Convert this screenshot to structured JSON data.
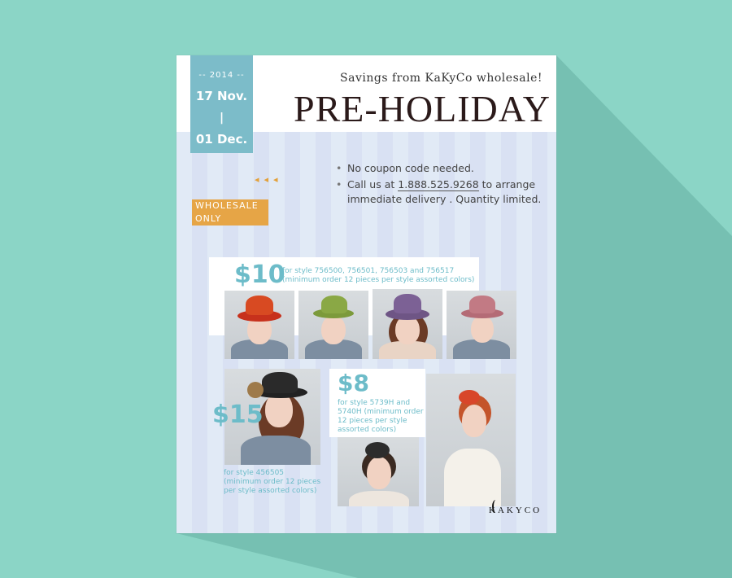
{
  "flyer": {
    "date_year": "-- 2014 --",
    "date_start": "17 Nov.",
    "date_sep": "|",
    "date_end": "01 Dec.",
    "tagline": "Savings from KaKyCo wholesale!",
    "headline": "PRE-HOLIDAY",
    "arrows": "◂◂◂",
    "wholesale_line1": "WHOLESALE",
    "wholesale_line2": "ONLY",
    "bullet1": "No coupon code needed.",
    "bullet2_prefix": "Call us at ",
    "phone": "1.888.525.9268",
    "bullet2_suffix": " to arrange immediate delivery .  Quantity limited.",
    "offer10_price": "$10",
    "offer10_note_line1": "for style 756500, 756501, 756503 and 756517",
    "offer10_note_line2": "(minimum order 12 pieces per style assorted colors)",
    "offer15_price": "$15",
    "offer15_note_line1": "for style 456505",
    "offer15_note_line2": "(minimum order 12 pieces",
    "offer15_note_line3": "per style assorted colors)",
    "offer8_price": "$8",
    "offer8_note_line1": "for style 5739H and",
    "offer8_note_line2": "5740H (minimum order",
    "offer8_note_line3": "12 pieces per style",
    "offer8_note_line4": "assorted colors)",
    "logo": "KAKYCO"
  },
  "colors": {
    "background": "#8bd5c6",
    "accent_teal": "#7cbcc9",
    "accent_orange": "#e6a546"
  }
}
